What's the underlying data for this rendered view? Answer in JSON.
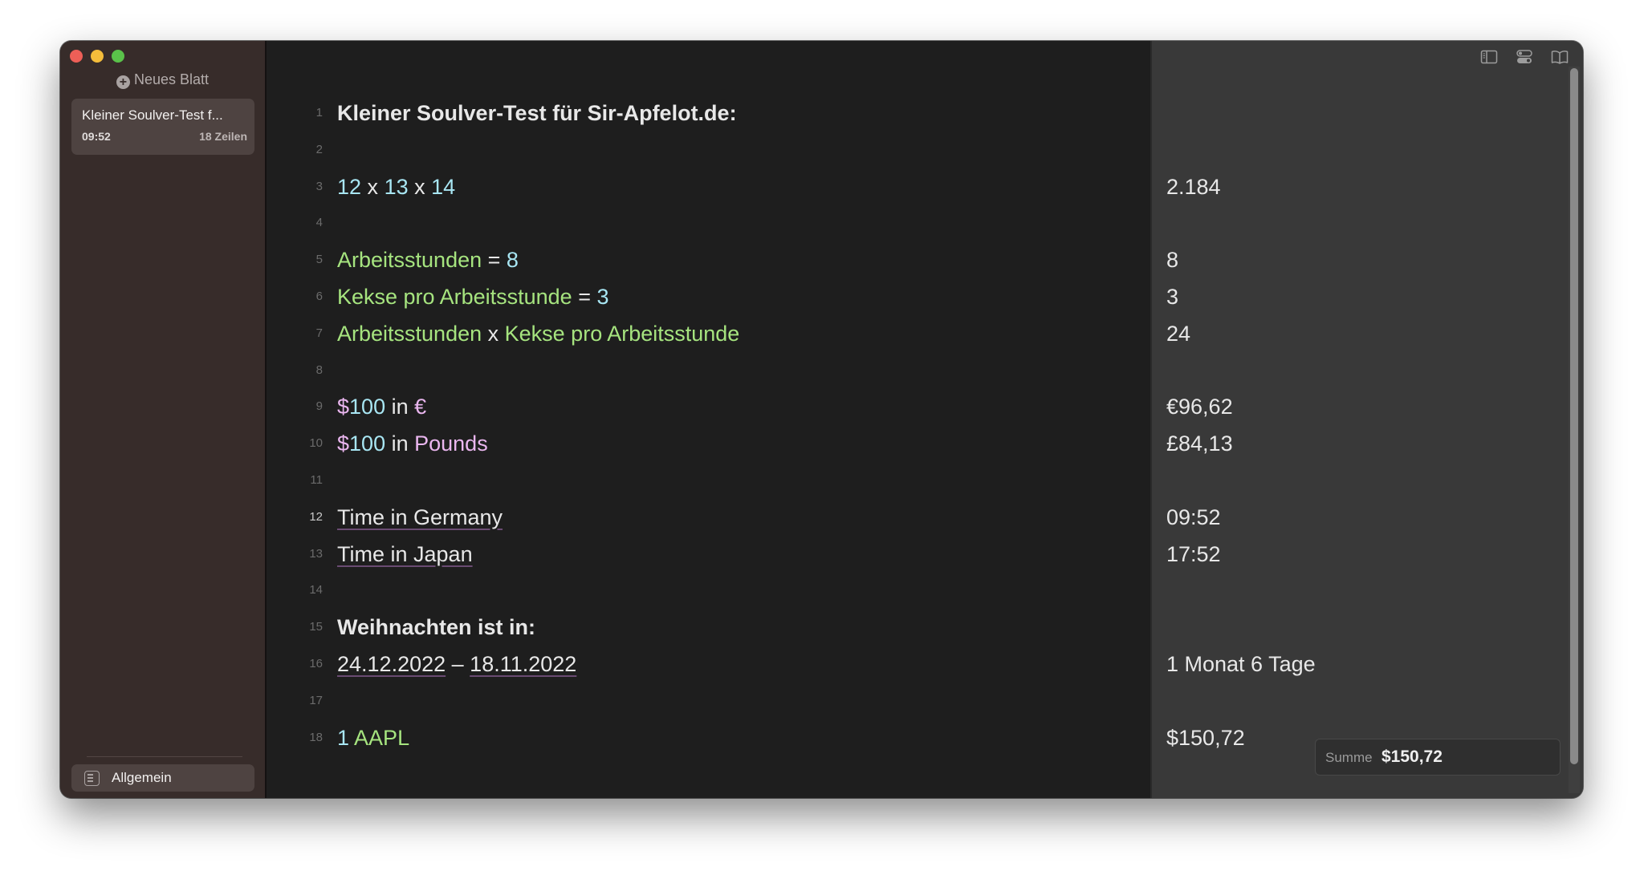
{
  "sidebar": {
    "new_sheet_label": "Neues Blatt",
    "sheets": [
      {
        "title": "Kleiner Soulver-Test f...",
        "time": "09:52",
        "lines": "18 Zeilen"
      }
    ],
    "category": "Allgemein"
  },
  "editor": {
    "current_line": 12,
    "lines": [
      {
        "n": "1",
        "text": "Kleiner Soulver-Test für Sir-Apfelot.de:",
        "result": ""
      },
      {
        "n": "2",
        "text": "",
        "result": ""
      },
      {
        "n": "3",
        "tokens": [
          "12",
          " x ",
          "13",
          " x ",
          "14"
        ],
        "result": "2.184"
      },
      {
        "n": "4",
        "text": "",
        "result": ""
      },
      {
        "n": "5",
        "tokens": [
          "Arbeitsstunden",
          " = ",
          "8"
        ],
        "result": "8"
      },
      {
        "n": "6",
        "tokens": [
          "Kekse pro Arbeitsstunde",
          " = ",
          "3"
        ],
        "result": "3"
      },
      {
        "n": "7",
        "tokens": [
          "Arbeitsstunden",
          " x ",
          "Kekse pro Arbeitsstunde"
        ],
        "result": "24"
      },
      {
        "n": "8",
        "text": "",
        "result": ""
      },
      {
        "n": "9",
        "tokens": [
          "$",
          "100",
          " in ",
          "€"
        ],
        "result": "€96,62"
      },
      {
        "n": "10",
        "tokens": [
          "$",
          "100",
          " in ",
          "Pounds"
        ],
        "result": "£84,13"
      },
      {
        "n": "11",
        "text": "",
        "result": ""
      },
      {
        "n": "12",
        "text": "Time in Germany",
        "result": "09:52"
      },
      {
        "n": "13",
        "text": "Time in Japan",
        "result": "17:52"
      },
      {
        "n": "14",
        "text": "",
        "result": ""
      },
      {
        "n": "15",
        "text": "Weihnachten ist in:",
        "result": ""
      },
      {
        "n": "16",
        "tokens": [
          "24.12.2022",
          " – ",
          "18.11.2022"
        ],
        "result": "1 Monat 6 Tage"
      },
      {
        "n": "17",
        "text": "",
        "result": ""
      },
      {
        "n": "18",
        "tokens": [
          "1",
          " AAPL"
        ],
        "result": "$150,72"
      }
    ]
  },
  "toolbar": {
    "icons": [
      "sidebar-toggle-icon",
      "toggles-icon",
      "book-icon"
    ]
  },
  "summary": {
    "label": "Summe",
    "value": "$150,72"
  },
  "colors": {
    "number": "#a8e6f3",
    "variable": "#a6e47f",
    "currency": "#eab6ef",
    "sidebar_bg": "#372c2a",
    "editor_bg": "#1e1e1e",
    "results_bg": "#393939"
  }
}
